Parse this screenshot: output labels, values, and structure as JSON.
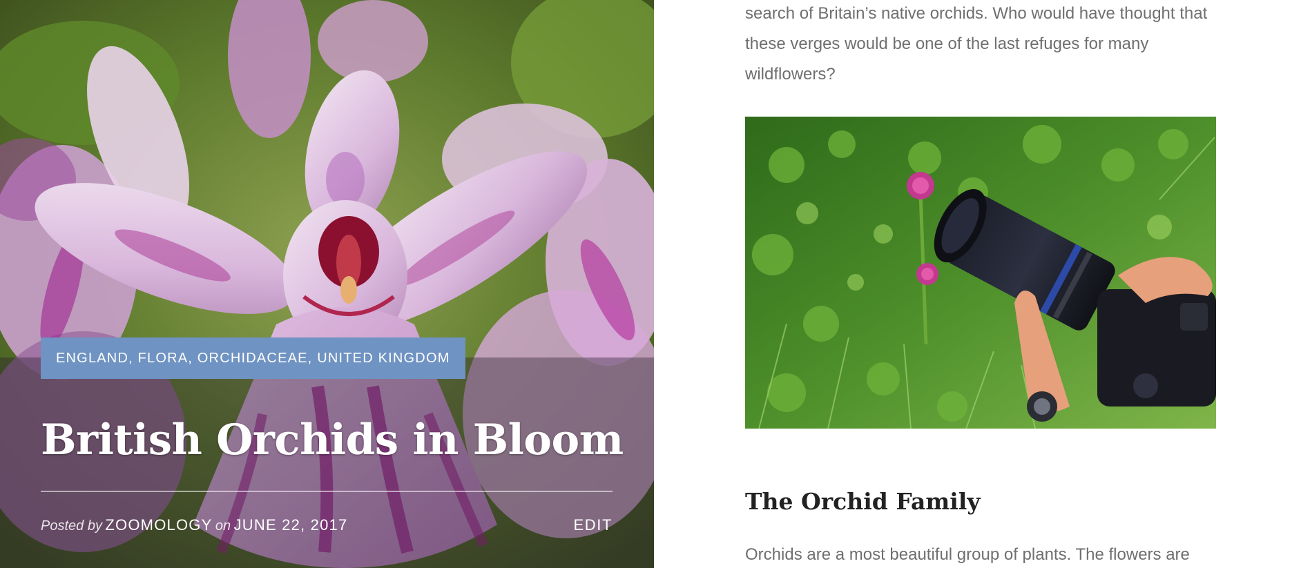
{
  "hero": {
    "categories": "ENGLAND, FLORA, ORCHIDACEAE, UNITED KINGDOM",
    "title": "British Orchids in Bloom",
    "meta": {
      "posted_by_prefix": "Posted by",
      "author": "ZOOMOLOGY",
      "date_prefix": "on",
      "date": "JUNE 22, 2017",
      "edit_label": "EDIT"
    }
  },
  "article": {
    "intro_paragraph": "search of Britain’s native orchids. Who would have thought that these verges would be one of the last refuges for many wildflowers?",
    "section_heading": "The Orchid Family",
    "body_paragraph": "Orchids are a most beautiful group of plants. The flowers are"
  },
  "colors": {
    "badge_background": "#6f93c2",
    "heading_text": "#222222",
    "body_text": "#6f6f6f",
    "hero_overlay": "rgba(40, 28, 44, 0.38)"
  }
}
